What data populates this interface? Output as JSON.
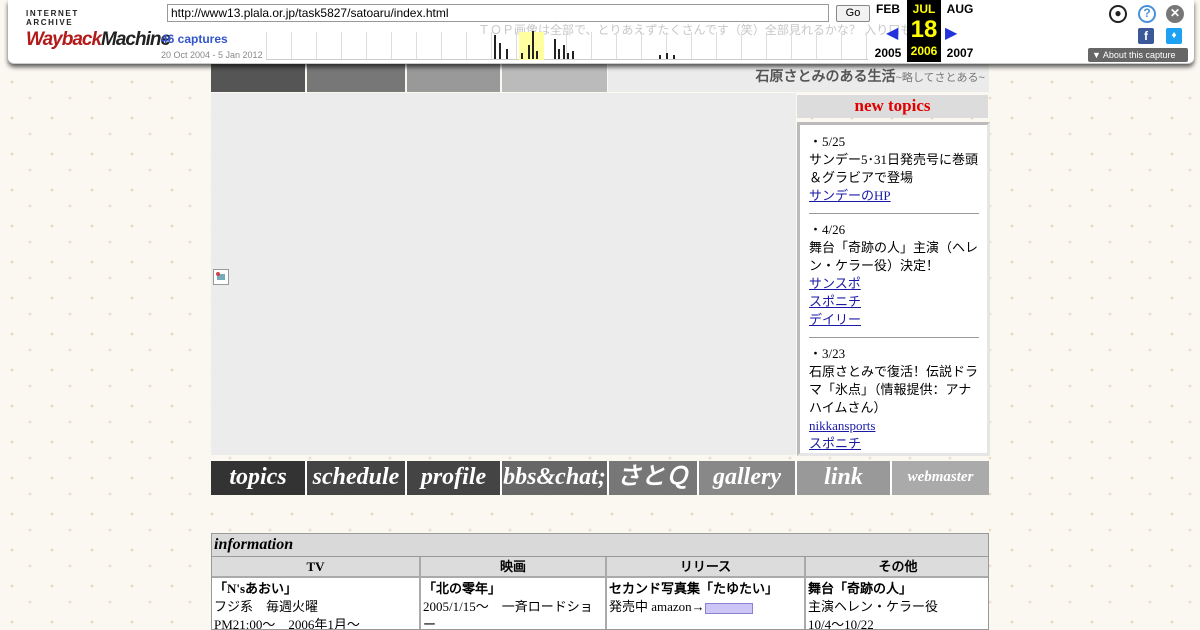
{
  "wayback": {
    "logo_line1": "INTERNET ARCHIVE",
    "logo_word_a": "Wayback",
    "logo_word_b": "Machine",
    "url": "http://www13.plala.or.jp/task5827/satoaru/index.html",
    "go_label": "Go",
    "captures": "46 captures",
    "date_range": "20 Oct 2004 - 5 Jan 2012",
    "prev_month": "FEB",
    "cur_month": "JUL",
    "next_month": "AUG",
    "cur_day": "18",
    "prev_year": "2005",
    "cur_year": "2006",
    "next_year": "2007",
    "about_label": "About this capture",
    "ghost_text": "ＴＯＰ画像は全部で、とりあえずたくさんです（笑）全部見れるかな？ 入り口も",
    "icons": [
      "user-icon",
      "help-icon",
      "close-icon",
      "facebook-icon",
      "twitter-icon"
    ]
  },
  "site": {
    "title": "石原さとみのある生活",
    "subtitle": "~略してさとある~",
    "header_tile_colors": [
      "#555555",
      "#777777",
      "#999999",
      "#bbbbbb"
    ]
  },
  "new_topics": {
    "heading": "new topics",
    "items": [
      {
        "date": "・5/25",
        "text": "サンデー5･31日発売号に巻頭＆グラビアで登場",
        "links": [
          "サンデーのHP"
        ]
      },
      {
        "date": "・4/26",
        "text": "舞台「奇跡の人」主演（ヘレン・ケラー役）決定！",
        "links": [
          "サンスポ",
          "スポニチ",
          "デイリー"
        ]
      },
      {
        "date": "・3/23",
        "text": "石原さとみで復活！伝説ドラマ「氷点」（情報提供：アナハイムさん）",
        "links": [
          "nikkansports",
          "スポニチ"
        ]
      }
    ]
  },
  "nav": [
    {
      "label": "topics",
      "color": "#333333"
    },
    {
      "label": "schedule",
      "color": "#444444"
    },
    {
      "label": "profile",
      "color": "#444444"
    },
    {
      "label": "bbs&chat;",
      "color": "#666666"
    },
    {
      "label": "さとＱ",
      "color": "#777777"
    },
    {
      "label": "gallery",
      "color": "#888888"
    },
    {
      "label": "link",
      "color": "#999999"
    },
    {
      "label": "webmaster",
      "color": "#aaaaaa"
    }
  ],
  "info": {
    "heading": "information",
    "columns": [
      {
        "header": "TV",
        "title": "「N'sあおい」",
        "lines": [
          "フジ系　毎週火曜",
          "PM21:00～　2006年1月～"
        ]
      },
      {
        "header": "映画",
        "title": "「北の零年」",
        "lines": [
          "2005/1/15～　一斉ロードショー"
        ]
      },
      {
        "header": "リリース",
        "title": "セカンド写真集「たゆたい」",
        "lines": [
          "発売中 amazon→"
        ]
      },
      {
        "header": "その他",
        "title": "舞台「奇跡の人」",
        "lines": [
          "主演ヘレン・ケラー役",
          "10/4～10/22"
        ]
      }
    ]
  }
}
